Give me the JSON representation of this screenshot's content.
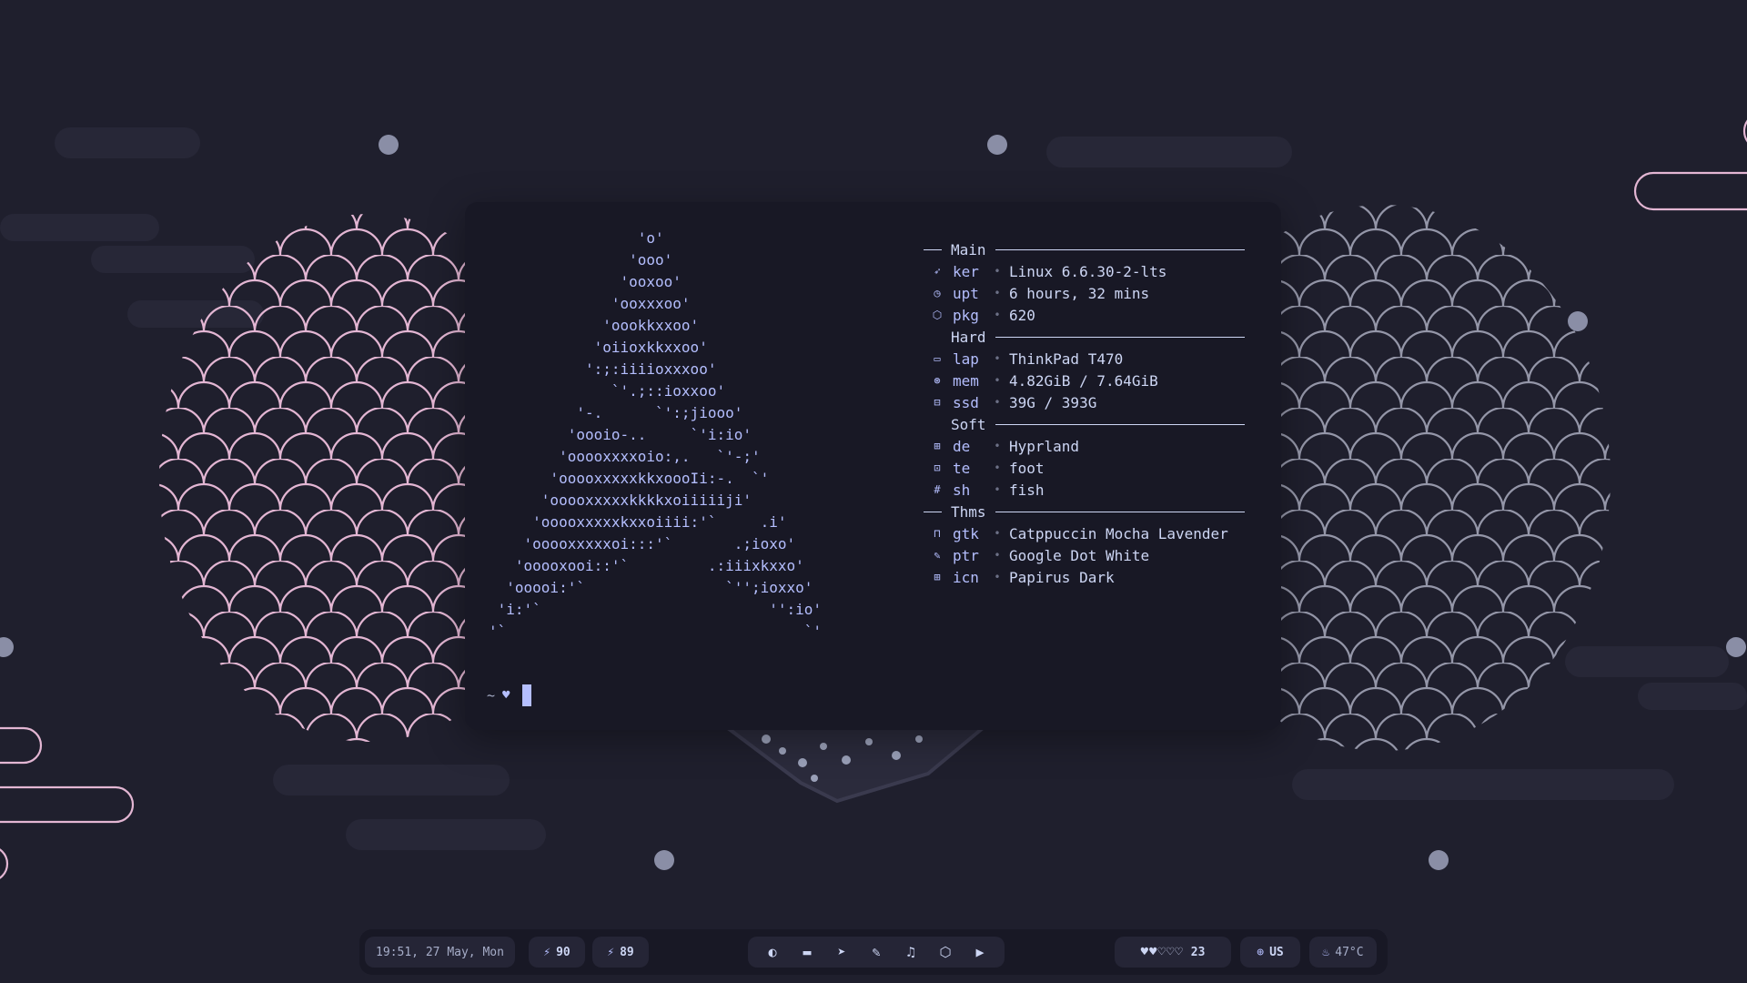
{
  "colors": {
    "background": "#1f1f2d",
    "terminal": "#181825",
    "accent_lavender": "#b4befe",
    "pink": "#f5c2e7",
    "text": "#cdd6f4",
    "muted": "#a6adc8"
  },
  "terminal": {
    "logo_lines": [
      "                 'o'",
      "                'ooo'",
      "               'ooxoo'",
      "              'ooxxxoo'",
      "             'oookkxxoo'",
      "            'oiioxkkxxoo'",
      "           ':;:iiiioxxxoo'",
      "              `'.;::ioxxoo'",
      "          '-.      `':;jiooo'",
      "         'oooio-..     `'i:io'",
      "        'ooooxxxxoio:,.   `'-;'",
      "       'ooooxxxxxkkxoooIi:-.  `'",
      "      'ooooxxxxxkkkkxoiiiiiji'",
      "     'ooooxxxxxkxxoiiii:'`     .i'",
      "    'ooooxxxxxoi:::'`       .;ioxo'",
      "   'ooooxooi::'`         .:iiixkxxo'",
      "  'ooooi:'`                `'';ioxxo'",
      " 'i:'`                          '':io'",
      "'`                                  `'"
    ],
    "sections": [
      {
        "title": "Main",
        "rows": [
          {
            "icon": "rocket-icon",
            "glyph": "➶",
            "key": "ker",
            "value": "Linux 6.6.30-2-lts"
          },
          {
            "icon": "clock-icon",
            "glyph": "◷",
            "key": "upt",
            "value": "6 hours, 32 mins"
          },
          {
            "icon": "package-icon",
            "glyph": "⬡",
            "key": "pkg",
            "value": "620"
          }
        ]
      },
      {
        "title": "Hard",
        "rows": [
          {
            "icon": "monitor-icon",
            "glyph": "▭",
            "key": "lap",
            "value": "ThinkPad T470"
          },
          {
            "icon": "chip-icon",
            "glyph": "⊛",
            "key": "mem",
            "value": "4.82GiB / 7.64GiB"
          },
          {
            "icon": "disk-icon",
            "glyph": "⊟",
            "key": "ssd",
            "value": "39G / 393G"
          }
        ]
      },
      {
        "title": "Soft",
        "rows": [
          {
            "icon": "window-icon",
            "glyph": "⊞",
            "key": "de",
            "value": "Hyprland"
          },
          {
            "icon": "terminal-icon",
            "glyph": "⊡",
            "key": "te",
            "value": "foot"
          },
          {
            "icon": "hash-icon",
            "glyph": "#",
            "key": "sh",
            "value": "fish"
          }
        ]
      },
      {
        "title": "Thms",
        "rows": [
          {
            "icon": "palette-icon",
            "glyph": "⊓",
            "key": "gtk",
            "value": "Catppuccin Mocha Lavender"
          },
          {
            "icon": "pen-icon",
            "glyph": "✎",
            "key": "ptr",
            "value": "Google Dot White"
          },
          {
            "icon": "grid-icon",
            "glyph": "⊞",
            "key": "icn",
            "value": "Papirus Dark"
          }
        ]
      }
    ],
    "prompt": {
      "path": "~",
      "symbol": "♥"
    }
  },
  "bar": {
    "clock": "19:51, 27 May, Mon",
    "battery1": "90",
    "battery2": "89",
    "apps": [
      {
        "name": "app-browser-icon",
        "glyph": "◐"
      },
      {
        "name": "app-window-icon",
        "glyph": "▬"
      },
      {
        "name": "app-telegram-icon",
        "glyph": "➤"
      },
      {
        "name": "app-paint-icon",
        "glyph": "✎"
      },
      {
        "name": "app-music-icon",
        "glyph": "♫"
      },
      {
        "name": "app-box-icon",
        "glyph": "⬡"
      },
      {
        "name": "app-play-icon",
        "glyph": "▶"
      }
    ],
    "hearts": "♥♥♡♡♡",
    "hearts_count": "23",
    "keyboard_layout": "US",
    "temperature": "47°C"
  }
}
